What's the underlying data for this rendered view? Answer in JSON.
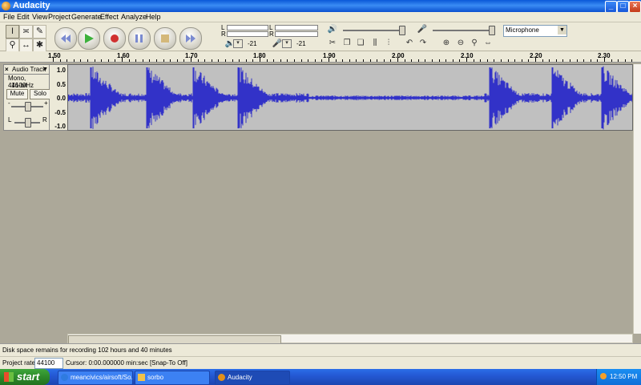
{
  "window": {
    "title": "Audacity",
    "buttons": [
      "_",
      "□",
      "×"
    ]
  },
  "menu": [
    "File",
    "Edit",
    "View",
    "Project",
    "Generate",
    "Effect",
    "Analyze",
    "Help"
  ],
  "tools": [
    "selection-tool",
    "envelope-tool",
    "draw-tool",
    "zoom-tool",
    "timeshift-tool",
    "multi-tool"
  ],
  "transport": [
    "skip-to-start",
    "play",
    "record",
    "pause",
    "stop",
    "skip-to-end"
  ],
  "meters": {
    "play_l": "L",
    "play_r": "R",
    "rec_l": "L",
    "rec_r": "R",
    "play_db": "-21",
    "rec_db": "-21"
  },
  "input_source": "Microphone",
  "ruler": {
    "labels": [
      "1.50",
      "1.60",
      "1.70",
      "1.80",
      "1.90",
      "2.00",
      "2.10",
      "2.20",
      "2.30"
    ]
  },
  "track": {
    "close": "×",
    "name": "Audio Track",
    "info1": "Mono, 44100Hz",
    "info2": "16-bit",
    "mute": "Mute",
    "solo": "Solo",
    "gain_minus": "-",
    "gain_plus": "+",
    "pan_left": "L",
    "pan_right": "R",
    "scale": [
      "1.0",
      "0.5",
      "0.0",
      "-0.5",
      "-1.0"
    ]
  },
  "status": {
    "disk": "Disk space remains for recording 102 hours and 40 minutes"
  },
  "selection": {
    "rate_label": "Project rate:",
    "rate": "44100",
    "cursor": "Cursor: 0:00.000000 min:sec  [Snap-To Off]"
  },
  "taskbar": {
    "start": "start",
    "tasks": [
      "meancivics/airsoft/So...",
      "sorbo",
      "Audacity"
    ],
    "clock": "12:50 PM"
  },
  "colors": {
    "waveform": "#3232c8",
    "wave_bg": "#c0c0c0",
    "titlebar": "#0a58d8",
    "taskbar": "#2459d4"
  }
}
